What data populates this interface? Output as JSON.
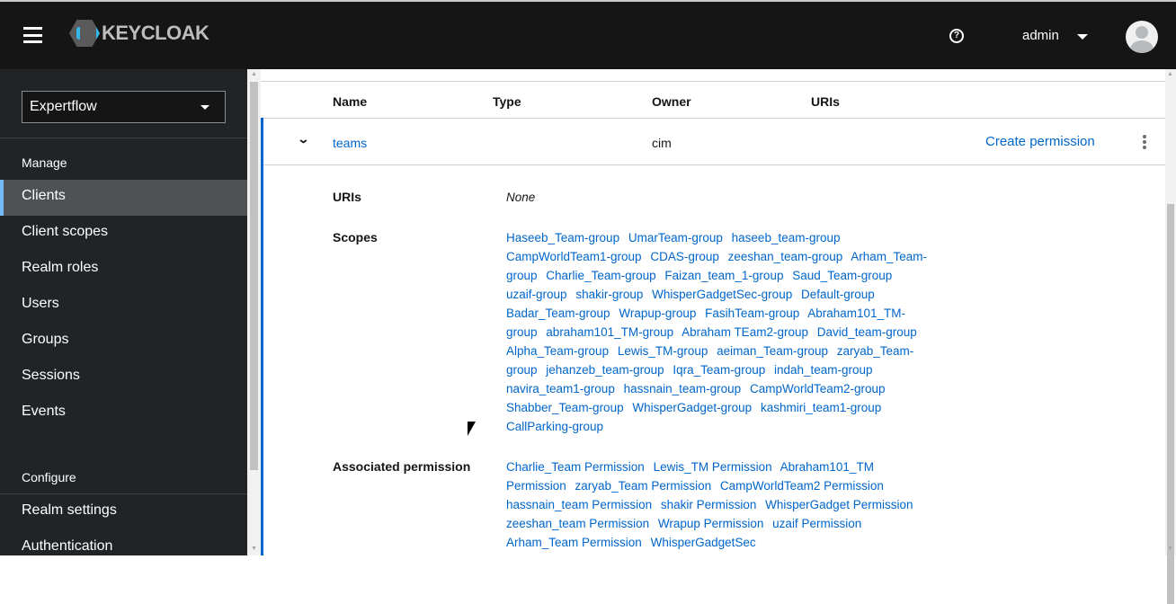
{
  "header": {
    "brand": "KEYCLOAK",
    "user": "admin"
  },
  "sidebar": {
    "realm": "Expertflow",
    "manage_label": "Manage",
    "configure_label": "Configure",
    "items": [
      "Clients",
      "Client scopes",
      "Realm roles",
      "Users",
      "Groups",
      "Sessions",
      "Events"
    ],
    "config_items": [
      "Realm settings",
      "Authentication"
    ]
  },
  "table": {
    "columns": [
      "Name",
      "Type",
      "Owner",
      "URIs"
    ],
    "row": {
      "name": "teams",
      "type": "",
      "owner": "cim",
      "action": "Create permission"
    },
    "details": {
      "uris_label": "URIs",
      "uris_value": "None",
      "scopes_label": "Scopes",
      "perm_label": "Associated permission",
      "scopes": [
        "Haseeb_Team-group",
        "UmarTeam-group",
        "haseeb_team-group",
        "CampWorldTeam1-group",
        "CDAS-group",
        "zeeshan_team-group",
        "Arham_Team-group",
        "Charlie_Team-group",
        "Faizan_team_1-group",
        "Saud_Team-group",
        "uzaif-group",
        "shakir-group",
        "WhisperGadgetSec-group",
        "Default-group",
        "Badar_Team-group",
        "Wrapup-group",
        "FasihTeam-group",
        "Abraham101_TM-group",
        "abraham101_TM-group",
        "Abraham TEam2-group",
        "David_team-group",
        "Alpha_Team-group",
        "Lewis_TM-group",
        "aeiman_Team-group",
        "zaryab_Team-group",
        "jehanzeb_team-group",
        "Iqra_Team-group",
        "indah_team-group",
        "navira_team1-group",
        "hassnain_team-group",
        "CampWorldTeam2-group",
        "Shabber_Team-group",
        "WhisperGadget-group",
        "kashmiri_team1-group",
        "CallParking-group"
      ],
      "permissions": [
        "Charlie_Team Permission",
        "Lewis_TM Permission",
        "Abraham101_TM Permission",
        "zaryab_Team Permission",
        "CampWorldTeam2 Permission",
        "hassnain_team Permission",
        "shakir Permission",
        "WhisperGadget Permission",
        "zeeshan_team Permission",
        "Wrapup Permission",
        "uzaif Permission",
        "Arham_Team Permission",
        "WhisperGadgetSec"
      ]
    }
  }
}
